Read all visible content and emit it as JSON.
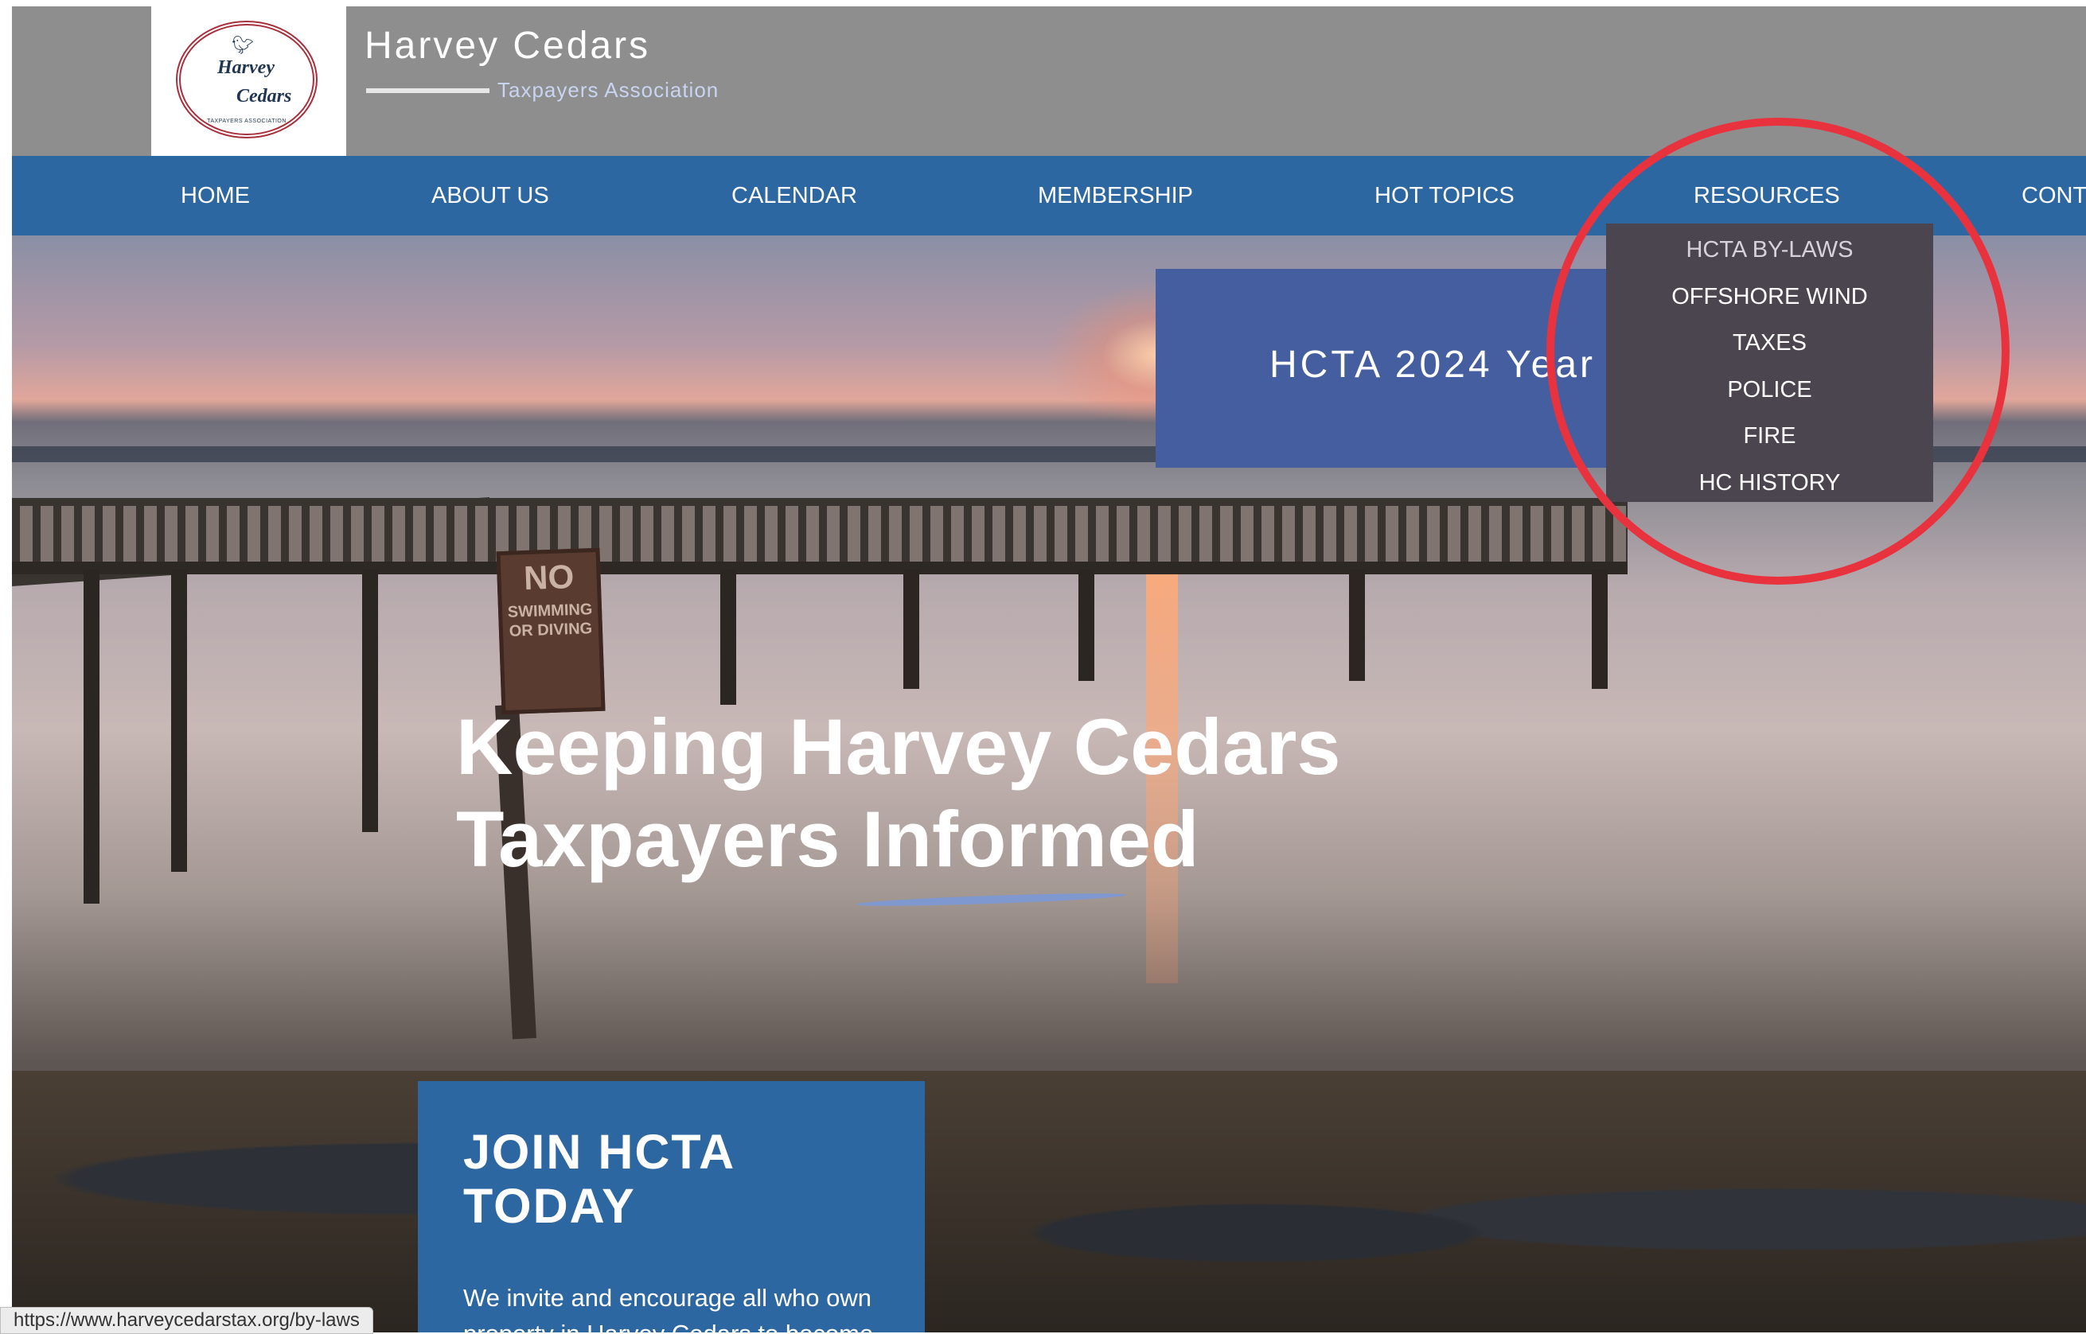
{
  "header": {
    "logo": {
      "line1": "Harvey",
      "line2": "Cedars",
      "sub": "TAXPAYERS ASSOCIATION"
    },
    "title": "Harvey Cedars",
    "subtitle": "Taxpayers Association"
  },
  "nav": {
    "items": [
      {
        "label": "HOME"
      },
      {
        "label": "ABOUT US"
      },
      {
        "label": "CALENDAR"
      },
      {
        "label": "MEMBERSHIP"
      },
      {
        "label": "HOT TOPICS"
      },
      {
        "label": "RESOURCES"
      },
      {
        "label": "CONT"
      }
    ]
  },
  "dropdown": {
    "items": [
      {
        "label": "HCTA BY-LAWS"
      },
      {
        "label": "OFFSHORE WIND"
      },
      {
        "label": "TAXES"
      },
      {
        "label": "POLICE"
      },
      {
        "label": "FIRE"
      },
      {
        "label": "HC HISTORY"
      }
    ]
  },
  "hero": {
    "banner": "HCTA 2024 Year",
    "headline_line1": "Keeping Harvey Cedars",
    "headline_line2": "Taxpayers Informed",
    "sign": {
      "big": "NO",
      "small": "SWIMMING OR DIVING"
    }
  },
  "join": {
    "title": "JOIN HCTA\nTODAY",
    "body": "We invite and encourage all who own property in Harvey Cedars to become"
  },
  "status_url": "https://www.harveycedarstax.org/by-laws",
  "colors": {
    "header_bg": "#8e8e8e",
    "nav_bg": "#2d67a2",
    "dropdown_bg": "#4b4550",
    "banner_bg": "#445ea0",
    "highlight": "#e8333f"
  }
}
